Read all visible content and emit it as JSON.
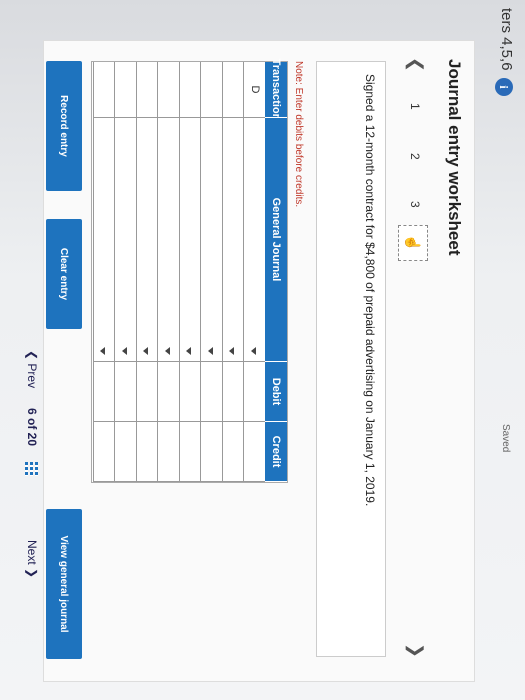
{
  "header": {
    "chapters": "ters 4,5,6",
    "info_icon": "i",
    "saved": "Saved"
  },
  "worksheet": {
    "title": "Journal entry worksheet",
    "pages": [
      "1",
      "2",
      "3"
    ],
    "prev_icon": "chevron-left-icon",
    "next_icon": "chevron-right-icon",
    "description": "Signed a 12-month contract for $4,800 of prepaid advertising on January 1, 2019.",
    "note": "Note: Enter debits before credits."
  },
  "table": {
    "headers": [
      "Transaction",
      "General Journal",
      "Debit",
      "Credit"
    ],
    "rows": [
      {
        "transaction": "D",
        "general_journal": "",
        "debit": "",
        "credit": ""
      },
      {
        "transaction": "",
        "general_journal": "",
        "debit": "",
        "credit": ""
      },
      {
        "transaction": "",
        "general_journal": "",
        "debit": "",
        "credit": ""
      },
      {
        "transaction": "",
        "general_journal": "",
        "debit": "",
        "credit": ""
      },
      {
        "transaction": "",
        "general_journal": "",
        "debit": "",
        "credit": ""
      },
      {
        "transaction": "",
        "general_journal": "",
        "debit": "",
        "credit": ""
      },
      {
        "transaction": "",
        "general_journal": "",
        "debit": "",
        "credit": ""
      },
      {
        "transaction": "",
        "general_journal": "",
        "debit": "",
        "credit": ""
      }
    ]
  },
  "buttons": {
    "record": "Record entry",
    "clear": "Clear entry",
    "view": "View general journal"
  },
  "footer": {
    "prev": "Prev",
    "position": "6 of 20",
    "next": "Next"
  },
  "colors": {
    "accent": "#1e73be",
    "note": "#c0392b"
  }
}
